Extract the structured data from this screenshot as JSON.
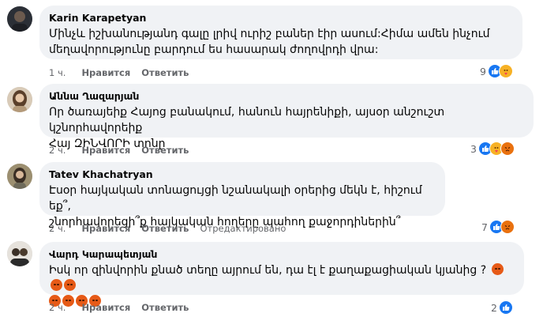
{
  "comments": [
    {
      "author": "Karin Karapetyan",
      "line1": "Մինչև իշխանությանդ գալը լրիվ ուրիշ բաներ էիր ասում:Հիմա ամեն ինչում",
      "line2": "մեղավորությունը բարդում ես հասարակ ժողովրդի վրա:",
      "time": "1 ч.",
      "like": "Нравится",
      "reply": "Ответить",
      "edited": "",
      "react_count": "9",
      "reactions": [
        "like",
        "care"
      ],
      "avatar_color": "#3b3f46"
    },
    {
      "author": "Աննա Ղազարյան",
      "line1": "Որ ծառայեիք Հայոց բանակում, հանուն հայրենիքի, այսօր անշուշտ կշնորհավորեիք",
      "line2": "Հայ ԶԻՆՎՈՐԻ տոնը",
      "time": "2 ч.",
      "like": "Нравится",
      "reply": "Ответить",
      "edited": "",
      "react_count": "3",
      "reactions": [
        "like",
        "care",
        "angry"
      ],
      "avatar_color": "#a88a6a"
    },
    {
      "author": "Tatev Khachatryan",
      "line1": "Էսօր հայկական տոնացույցի նշանակալի օրերից մեկն է, հիշում եք՞,",
      "line2": "շնորհավորեցի՞ք հայկական հողերը պահող քաջորդիներին՞",
      "time": "2 ч.",
      "like": "Нравится",
      "reply": "Ответить",
      "edited": "Отредактировано",
      "react_count": "7",
      "reactions": [
        "like",
        "angry"
      ],
      "avatar_color": "#8a7a5a"
    },
    {
      "author": "Վարդ Կարապետյան",
      "line1": "Իսկ որ զինվորին քնած տեղը այրում են, դա էլ է քաղաքացիական կյանից ?",
      "line2": "",
      "time": "2 ч.",
      "like": "Нравится",
      "reply": "Ответить",
      "edited": "",
      "react_count": "2",
      "reactions": [
        "like"
      ],
      "avatar_color": "#555b63"
    }
  ],
  "icons": {
    "like": "thumbs-up-icon",
    "care": "care-icon",
    "angry": "angry-icon"
  },
  "colors": {
    "bubble": "#f0f2f5",
    "like": "#1877f2",
    "care": "#f7b125",
    "angry": "#e9710f",
    "meta": "#65676b"
  }
}
